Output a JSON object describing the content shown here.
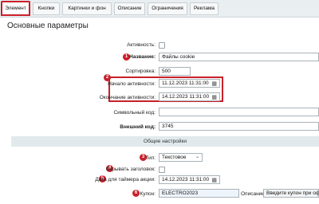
{
  "tabs": [
    {
      "label": "Элемент"
    },
    {
      "label": "Кнопки"
    },
    {
      "label": "Картинки и фон"
    },
    {
      "label": "Описание"
    },
    {
      "label": "Ограничения"
    },
    {
      "label": "Реклама"
    }
  ],
  "page_title": "Основные параметры",
  "fields": {
    "active": {
      "label": "Активность:"
    },
    "name": {
      "label": "Название:",
      "value": "Файлы cookie",
      "badge": "1"
    },
    "sort": {
      "label": "Сортировка:",
      "value": "500"
    },
    "start": {
      "label": "Начало активности:",
      "value": "11.12.2023 11:31:00",
      "badge": "2"
    },
    "end": {
      "label": "Окончание активности:",
      "value": "14.12.2023 11:31:00"
    },
    "symbol_code": {
      "label": "Символьный код:",
      "value": ""
    },
    "external_code": {
      "label": "Внешний код:",
      "value": "3745"
    }
  },
  "section_title": "Общие настройки",
  "general": {
    "type": {
      "label": "Тип:",
      "value": "Текстовое",
      "badge": "3"
    },
    "hide_title": {
      "label": "Скрывать заголовок:",
      "badge": "4"
    },
    "timer_date": {
      "label": "Дата для таймера акции:",
      "value": "14.12.2023 11:31:00",
      "badge": "5"
    },
    "coupon": {
      "label": "Купон:",
      "value": "ELECTRO2023",
      "badge": "6"
    },
    "description": {
      "label": "Описание:",
      "placeholder": "Введите купон при офо"
    }
  },
  "colors": {
    "accent_red": "#c8202a",
    "tab_bar": "#e9eef0",
    "section_bar": "#e1e9ec"
  },
  "icons": {
    "calendar": "calendar-icon",
    "chevron": "chevron-down-icon"
  }
}
